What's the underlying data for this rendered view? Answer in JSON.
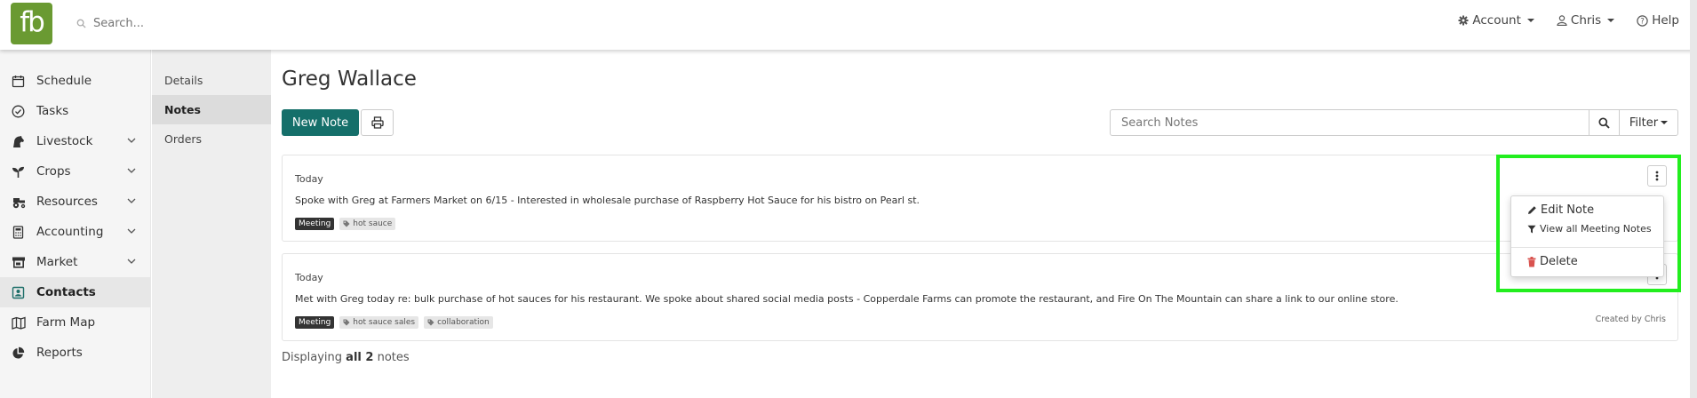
{
  "app": {
    "logo_text": "fb",
    "brand_color": "#6a9a32",
    "search_placeholder": "Search..."
  },
  "topnav": {
    "account_label": "Account",
    "user_label": "Chris",
    "help_label": "Help"
  },
  "sidebar": {
    "items": [
      {
        "label": "Schedule",
        "icon": "calendar-icon"
      },
      {
        "label": "Tasks",
        "icon": "check-circle-icon"
      },
      {
        "label": "Livestock",
        "icon": "horse-icon"
      },
      {
        "label": "Crops",
        "icon": "seedling-icon"
      },
      {
        "label": "Resources",
        "icon": "tractor-icon"
      },
      {
        "label": "Accounting",
        "icon": "calculator-icon"
      },
      {
        "label": "Market",
        "icon": "store-icon"
      },
      {
        "label": "Contacts",
        "icon": "contact-card-icon"
      },
      {
        "label": "Farm Map",
        "icon": "map-icon"
      },
      {
        "label": "Reports",
        "icon": "pie-chart-icon"
      }
    ],
    "active": "Contacts"
  },
  "subnav": {
    "items": [
      "Details",
      "Notes",
      "Orders"
    ],
    "active": "Notes"
  },
  "main": {
    "title": "Greg Wallace",
    "new_note_label": "New Note",
    "search_notes_placeholder": "Search Notes",
    "filter_label": "Filter",
    "accent_color": "#156f6a"
  },
  "notes": [
    {
      "date": "Today",
      "text": "Spoke with Greg at Farmers Market on 6/15 - Interested in wholesale purchase of Raspberry Hot Sauce for his bistro on Pearl st.",
      "type_tag": "Meeting",
      "tags": [
        "hot sauce"
      ]
    },
    {
      "date": "Today",
      "text": "Met with Greg today re: bulk purchase of hot sauces for his restaurant. We spoke about shared social media posts - Copperdale Farms can promote the restaurant, and Fire On The Mountain can share a link to our online store.",
      "type_tag": "Meeting",
      "tags": [
        "hot sauce sales",
        "collaboration"
      ],
      "created_by": "Created by Chris"
    }
  ],
  "dropdown": {
    "edit_label": "Edit Note",
    "view_all_label": "View all Meeting Notes",
    "delete_label": "Delete",
    "delete_color": "#d9534f"
  },
  "footer": {
    "prefix": "Displaying",
    "count": "all 2",
    "suffix": "notes"
  },
  "highlight_color": "#22ee1e"
}
